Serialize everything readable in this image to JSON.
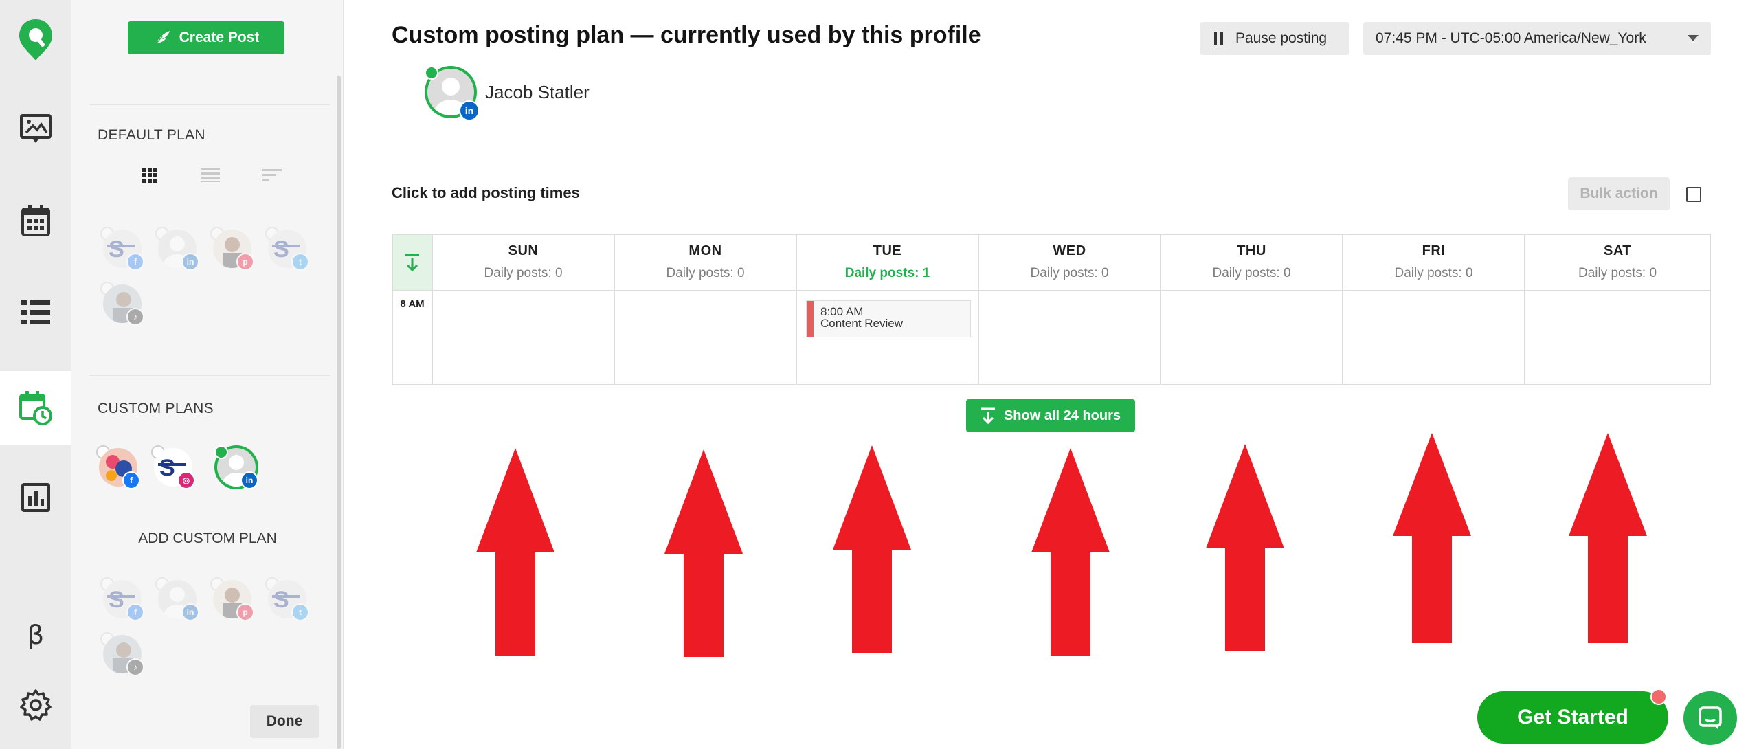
{
  "sidebar": {
    "create_post": "Create Post",
    "default_plan": "DEFAULT PLAN",
    "custom_plans": "CUSTOM PLANS",
    "add_custom_plan": "ADD CUSTOM PLAN",
    "done": "Done"
  },
  "rail": {
    "beta": "β"
  },
  "header": {
    "title": "Custom posting plan — currently used by this profile",
    "pause": "Pause posting",
    "timezone": "07:45 PM - UTC-05:00 America/New_York"
  },
  "profile": {
    "name": "Jacob Statler",
    "network": "linkedin"
  },
  "schedule": {
    "label": "Click to add posting times",
    "bulk_action": "Bulk action",
    "time_row": "8 AM",
    "days": [
      {
        "name": "SUN",
        "posts": "Daily posts: 0"
      },
      {
        "name": "MON",
        "posts": "Daily posts: 0"
      },
      {
        "name": "TUE",
        "posts": "Daily posts: 1"
      },
      {
        "name": "WED",
        "posts": "Daily posts: 0"
      },
      {
        "name": "THU",
        "posts": "Daily posts: 0"
      },
      {
        "name": "FRI",
        "posts": "Daily posts: 0"
      },
      {
        "name": "SAT",
        "posts": "Daily posts: 0"
      }
    ],
    "slot": {
      "time": "8:00 AM",
      "title": "Content Review",
      "day": "TUE"
    },
    "show_all": "Show all 24 hours"
  },
  "cta": {
    "get_started": "Get Started"
  },
  "colors": {
    "brand_green": "#22b14c",
    "annotation_red": "#ed1c24",
    "slot_bar": "#e06060"
  },
  "icons": [
    "location-pin-icon",
    "chart-image-icon",
    "calendar-icon",
    "list-icon",
    "calendar-clock-icon",
    "bar-chart-icon",
    "gear-icon",
    "feather-icon",
    "grid-view-icon",
    "list-view-icon",
    "sort-icon",
    "pause-icon",
    "chevron-down-icon",
    "expand-arrow-icon",
    "chat-icon"
  ]
}
